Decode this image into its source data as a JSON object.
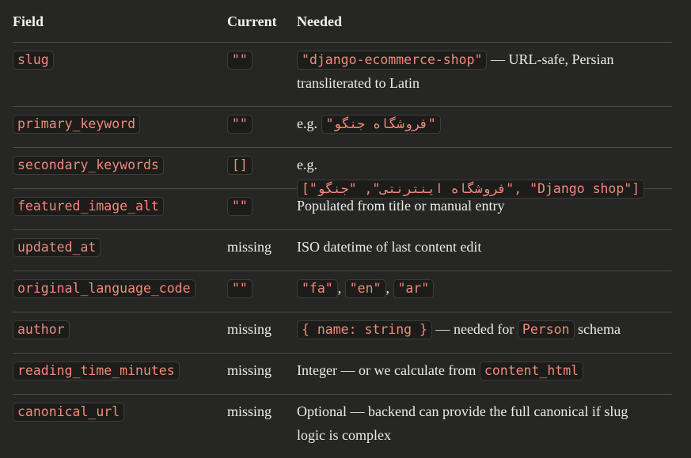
{
  "header": {
    "field": "Field",
    "current": "Current",
    "needed": "Needed"
  },
  "rows": [
    {
      "field": "slug",
      "current": "\"\"",
      "needed_code": "\"django-ecommerce-shop\"",
      "needed_text": " — URL-safe, Persian transliterated to Latin"
    },
    {
      "field": "primary_keyword",
      "current": "\"\"",
      "needed_prefix": "e.g. ",
      "needed_code": "\"فروشگاه جنگو\""
    },
    {
      "field": "secondary_keywords",
      "current": "[]",
      "needed_prefix": "e.g. ",
      "needed_code": "[\"فروشگاه اینترنتی\", \"جنگو\", \"Django shop\"]"
    },
    {
      "field": "featured_image_alt",
      "current": "\"\"",
      "needed_text": "Populated from title or manual entry"
    },
    {
      "field": "updated_at",
      "current": "missing",
      "needed_text": "ISO datetime of last content edit"
    },
    {
      "field": "original_language_code",
      "current": "\"\"",
      "needed_codes": [
        "\"fa\"",
        "\"en\"",
        "\"ar\""
      ],
      "needed_sep": ", "
    },
    {
      "field": "author",
      "current": "missing",
      "needed_code": "{ name: string }",
      "needed_mid": " — needed for ",
      "needed_code2": "Person",
      "needed_suffix": " schema"
    },
    {
      "field": "reading_time_minutes",
      "current": "missing",
      "needed_text": "Integer — or we calculate from ",
      "needed_code": "content_html"
    },
    {
      "field": "canonical_url",
      "current": "missing",
      "needed_text": "Optional — backend can provide the full canonical if slug logic is complex"
    }
  ]
}
